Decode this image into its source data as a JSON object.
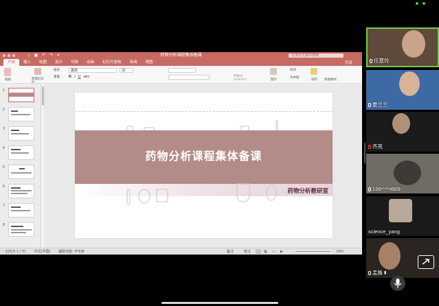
{
  "colors": {
    "accent": "#c76a62",
    "slide_band": "#b38b88",
    "active_speaker": "#6fcf45",
    "dept_text": "#5b2e3d"
  },
  "titlebar": {
    "title": "药物分析课程集体备课",
    "search_placeholder": "在演示文稿中搜索"
  },
  "ribbon": {
    "tabs": [
      "开始",
      "插入",
      "绘图",
      "设计",
      "切换",
      "动画",
      "幻灯片放映",
      "审阅",
      "视图"
    ],
    "share_label": "共享",
    "paste_label": "粘贴",
    "new_slide_label": "新建幻灯片",
    "layout_label": "版式",
    "reset_label": "重置",
    "font_name": "黑体",
    "font_size": "32",
    "convert_label": "转换为SmartArt",
    "picture_label": "图片",
    "shape_label": "形状",
    "textbox_label": "文本框",
    "arrange_label": "排列",
    "quickstyle_label": "快速样式"
  },
  "thumbnails": [
    "1",
    "2",
    "3",
    "4",
    "5",
    "6",
    "7",
    "8"
  ],
  "slide": {
    "title": "药物分析课程集体备课",
    "department": "药物分析教研室"
  },
  "statusbar": {
    "slide_count": "幻灯片 1 / 70",
    "language": "中文(中国)",
    "accessibility": "辅助功能: 不可用",
    "notes": "备注",
    "comments": "批注",
    "zoom": "66%"
  },
  "participants": [
    {
      "name": "任慧玲",
      "mic": "on",
      "active": true
    },
    {
      "name": "夏兰兰",
      "mic": "on",
      "active": false
    },
    {
      "name": "齐亮",
      "mic": "muted",
      "active": false
    },
    {
      "name": "136****4909",
      "mic": "on",
      "active": false
    },
    {
      "name": "science_yang",
      "mic": "none",
      "active": false
    },
    {
      "name": "孟姝",
      "mic": "on",
      "active": false
    }
  ]
}
